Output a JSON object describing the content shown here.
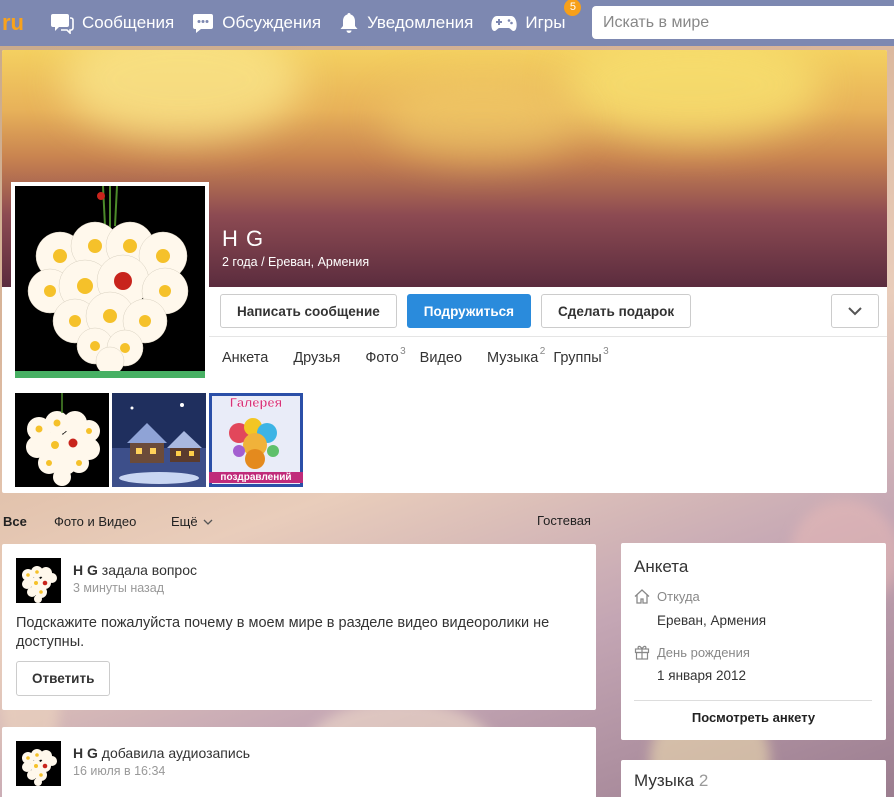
{
  "topbar": {
    "logo": "ru",
    "nav": [
      {
        "label": "Сообщения",
        "icon": "messages-icon"
      },
      {
        "label": "Обсуждения",
        "icon": "discussions-icon"
      },
      {
        "label": "Уведомления",
        "icon": "bell-icon"
      },
      {
        "label": "Игры",
        "icon": "gamepad-icon",
        "badge": "5"
      }
    ],
    "search_placeholder": "Искать в мире"
  },
  "profile": {
    "name": "H G",
    "subtitle": "2 года / Ереван, Армения",
    "buttons": {
      "message": "Написать сообщение",
      "friend": "Подружиться",
      "gift": "Сделать подарок"
    },
    "tabs": [
      {
        "label": "Анкета",
        "count": ""
      },
      {
        "label": "Друзья",
        "count": ""
      },
      {
        "label": "Фото",
        "count": "3"
      },
      {
        "label": "Видео",
        "count": ""
      },
      {
        "label": "Музыка",
        "count": "2"
      },
      {
        "label": "Группы",
        "count": "3"
      }
    ],
    "gallery_caption_top": "Галерея",
    "gallery_caption_bottom": "поздравлений"
  },
  "feed_filter": {
    "all": "Все",
    "photo_video": "Фото и Видео",
    "more": "Ещё",
    "guestbook": "Гостевая"
  },
  "posts": [
    {
      "author": "H G",
      "action": "задала вопрос",
      "time": "3 минуты назад",
      "text": "Подскажите пожалуйста почему в моем мире в разделе видео видеоролики не доступны.",
      "reply": "Ответить"
    },
    {
      "author": "H G",
      "action": "добавила аудиозапись",
      "time": "16 июля в 16:34"
    }
  ],
  "side": {
    "title": "Анкета",
    "from_label": "Откуда",
    "from_value": "Ереван, Армения",
    "birthday_label": "День рождения",
    "birthday_value": "1 января 2012",
    "link": "Посмотреть анкету"
  },
  "music": {
    "title": "Музыка",
    "count": "2"
  },
  "colors": {
    "topbar": "#7d88b1",
    "accent_blue": "#2a8bdc",
    "badge": "#f7a01a",
    "green": "#47b063"
  }
}
